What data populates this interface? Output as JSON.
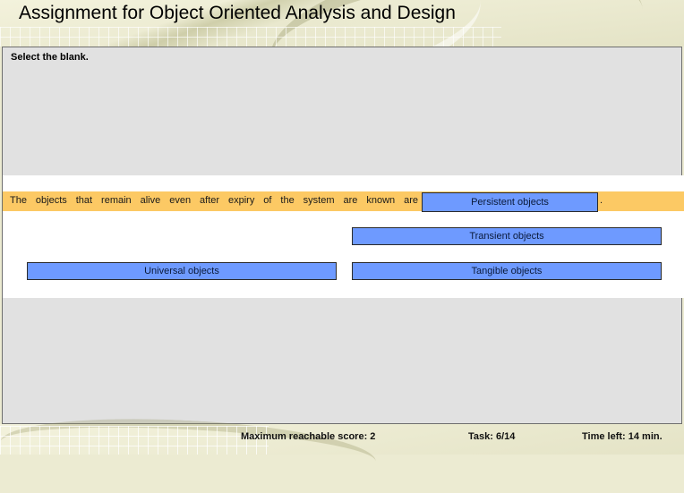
{
  "app": {
    "title": "Assignment for Object Oriented Analysis and Design"
  },
  "question": {
    "instruction": "Select the blank.",
    "text": "The objects that remain alive even after expiry of the system are known are",
    "blank_answer": "Persistent objects",
    "trailing": "."
  },
  "options": {
    "transient": "Transient objects",
    "universal": "Universal objects",
    "tangible": "Tangible objects"
  },
  "footer": {
    "max_score": "Maximum reachable score: 2",
    "task": "Task: 6/14",
    "time_left": "Time left: 14 min."
  },
  "colors": {
    "question_bar": "#fcc964",
    "answer_box": "#6e9aff",
    "panel": "#e1e1e1"
  }
}
